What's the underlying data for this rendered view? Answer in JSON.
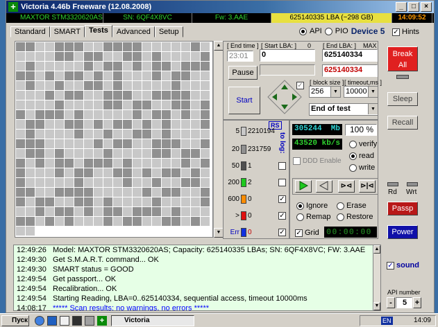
{
  "window": {
    "title": "Victoria 4.46b Freeware (12.08.2008)",
    "controls": [
      "_",
      "□",
      "×"
    ]
  },
  "infobar": {
    "model": "MAXTOR STM3320620AS",
    "serial": "SN: 6QF4X8VC",
    "firmware": "Fw: 3.AAE",
    "lba": "625140335 LBA (~298 GB)",
    "clock": "14:09:52"
  },
  "tabs": [
    "Standard",
    "SMART",
    "Tests",
    "Advanced",
    "Setup"
  ],
  "api": {
    "api_label": "API",
    "pio_label": "PIO",
    "device": "Device 5",
    "hints_label": "Hints",
    "hints_checked": "✓"
  },
  "test": {
    "end_time_label": "[ End time ]",
    "end_time": "23:01",
    "start_lba_label": "[ Start LBA: ]",
    "start_zero": "0",
    "start_lba": "0",
    "end_lba_label": "[ End LBA: ]",
    "max_label": "MAX",
    "end_lba": "625140334",
    "end_lba_red": "625140334",
    "pause_label": "Pause",
    "start_label": "Start",
    "block_size_label": "[ block size ]",
    "block_size": "256",
    "timeout_label": "[ timeout,ms ]",
    "timeout": "10000",
    "end_mode": "End of test"
  },
  "legend": {
    "rs_label": "RS",
    "to_log_label": "to log:",
    "rows": [
      {
        "ms": "5",
        "count": "2210194",
        "color": "#c8c8c8"
      },
      {
        "ms": "20",
        "count": "231759",
        "color": "#909090"
      },
      {
        "ms": "50",
        "count": "1",
        "color": "#505050"
      },
      {
        "ms": "200",
        "count": "2",
        "color": "#1ec81e"
      },
      {
        "ms": "600",
        "count": "0",
        "color": "#ff8c00"
      },
      {
        "ms": ">",
        "count": "0",
        "color": "#e01010"
      },
      {
        "ms": "Err",
        "count": "0",
        "color": "#1030e0"
      }
    ],
    "ddd_label": "DDD Enable"
  },
  "status": {
    "mb": "305244",
    "mb_unit": "Mb",
    "percent": "100",
    "percent_unit": "%",
    "speed": "43520",
    "speed_unit": "kb/s",
    "verify_label": "verify",
    "read_label": "read",
    "write_label": "write",
    "ignore_label": "Ignore",
    "erase_label": "Erase",
    "remap_label": "Remap",
    "restore_label": "Restore",
    "grid_label": "Grid",
    "grid_checked": "✓",
    "timer": "00:00:00"
  },
  "right": {
    "break_all": "Break All",
    "sleep": "Sleep",
    "recall": "Recall",
    "rd": "Rd",
    "wrt": "Wrt",
    "passp": "Passp",
    "power": "Power",
    "sound_label": "sound",
    "sound_checked": "✓",
    "api_number_label": "API number",
    "api_number": "5",
    "minus": "-",
    "plus": "+"
  },
  "log": [
    {
      "time": "12:49:26",
      "msg": "Model: MAXTOR STM3320620AS; Capacity: 625140335 LBAs; SN: 6QF4X8VC; FW: 3.AAE"
    },
    {
      "time": "12:49:30",
      "msg": "Get S.M.A.R.T. command... OK"
    },
    {
      "time": "12:49:30",
      "msg": "SMART status = GOOD"
    },
    {
      "time": "12:49:54",
      "msg": "Get passport... OK"
    },
    {
      "time": "12:49:54",
      "msg": "Recalibration... OK"
    },
    {
      "time": "12:49:54",
      "msg": "Starting Reading, LBA=0..625140334, sequential access, timeout 10000ms"
    },
    {
      "time": "14:08:17",
      "msg": "***** Scan results: no warnings, no errors *****"
    }
  ],
  "taskbar": {
    "start": "Пуск",
    "task": "Victoria",
    "lang": "EN",
    "clock": "14:09"
  }
}
